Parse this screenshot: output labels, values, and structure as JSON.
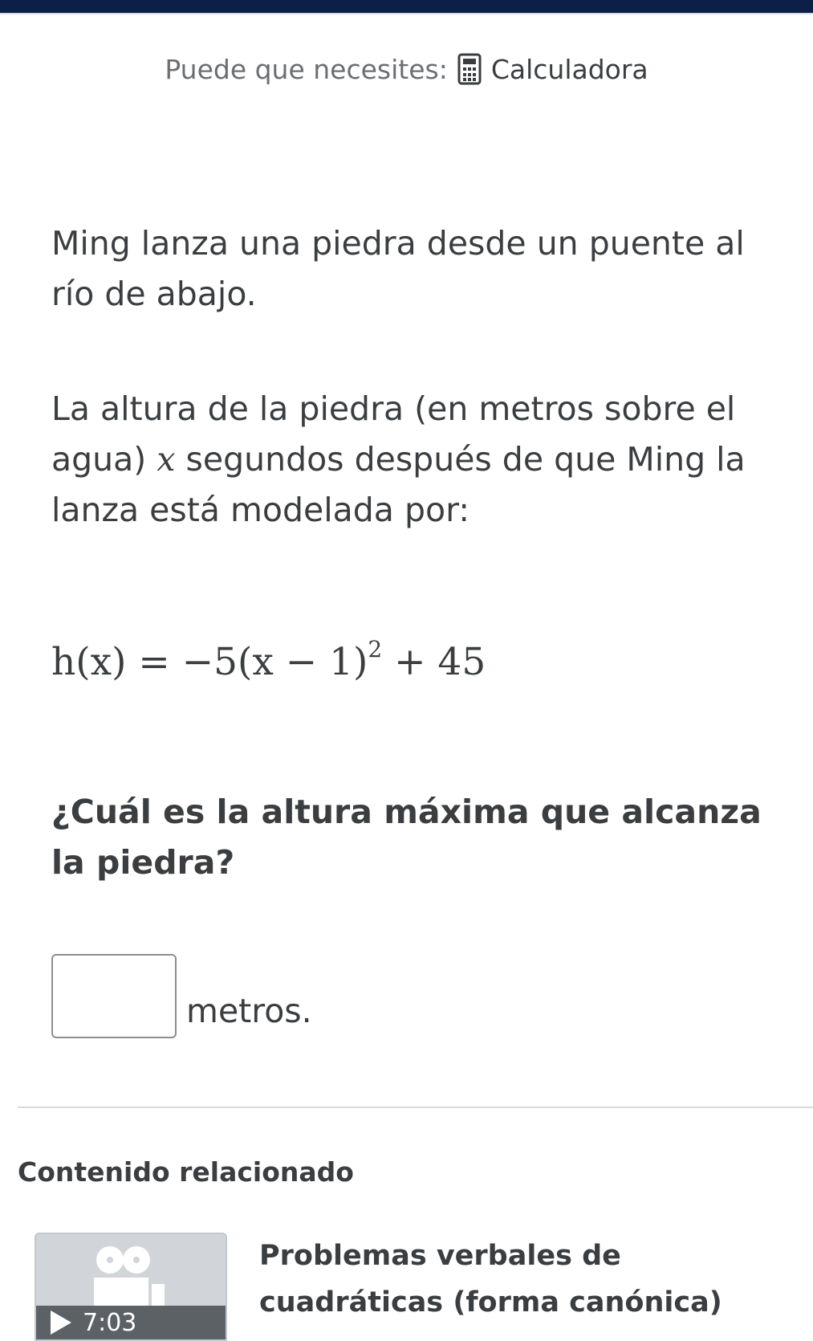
{
  "tools": {
    "hint": "Puede que necesites:",
    "calculator_label": "Calculadora"
  },
  "problem": {
    "paragraph1": "Ming lanza una piedra desde un puente al río de abajo.",
    "paragraph2_var": "x",
    "paragraph2_start": "La altura de la piedra (en metros sobre el agua)",
    "paragraph2_end": "segundos después de que Ming la lanza está modelada por:",
    "formula_main": "h(x) = −5(x − 1)",
    "formula_exponent": "2",
    "formula_tail": " + 45",
    "question": "¿Cuál es la altura máxima que alcanza la piedra?",
    "answer_value": "",
    "unit": "metros."
  },
  "related": {
    "heading": "Contenido relacionado",
    "video": {
      "title": "Problemas verbales de cuadráticas (forma canónica)",
      "duration": "7:03",
      "icon": "video-camera-icon"
    }
  },
  "colors": {
    "top_bar": "#0b1f47",
    "text": "#3b3e40",
    "muted_text": "#6b6f72"
  }
}
